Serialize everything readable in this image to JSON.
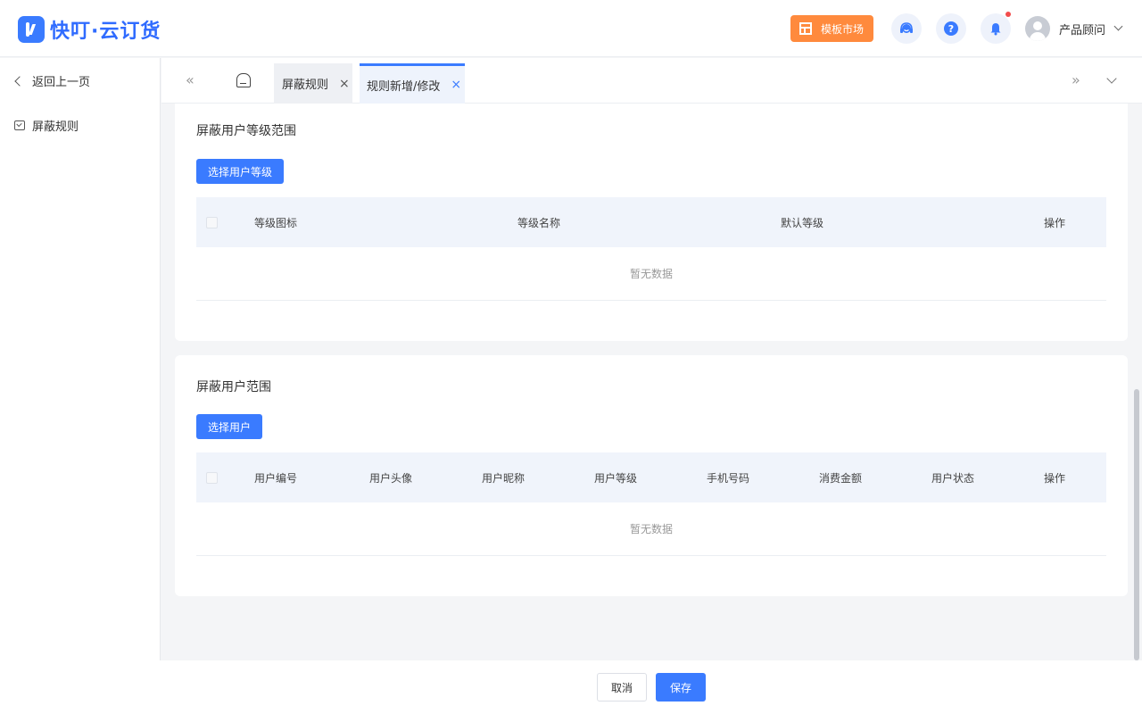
{
  "header": {
    "logo_text": "快叮·云订货",
    "template_market_label": "模板市场",
    "help_glyph": "?",
    "user_name": "产品顾问"
  },
  "sidebar": {
    "back_label": "返回上一页",
    "items": [
      {
        "label": "屏蔽规则",
        "icon": "checkbox-icon"
      }
    ]
  },
  "tabs": {
    "prev_glyph": "«",
    "next_glyph": "»",
    "close_glyph": "×",
    "items": [
      {
        "label": "屏蔽规则",
        "active": false
      },
      {
        "label": "规则新增/修改",
        "active": true
      }
    ]
  },
  "level_section": {
    "title": "屏蔽用户等级范围",
    "button_label": "选择用户等级",
    "columns": [
      "等级图标",
      "等级名称",
      "默认等级",
      "操作"
    ],
    "empty_text": "暂无数据"
  },
  "user_section": {
    "title": "屏蔽用户范围",
    "button_label": "选择用户",
    "columns": [
      "用户编号",
      "用户头像",
      "用户昵称",
      "用户等级",
      "手机号码",
      "消费金额",
      "用户状态",
      "操作"
    ],
    "empty_text": "暂无数据"
  },
  "footer": {
    "cancel_label": "取消",
    "save_label": "保存"
  },
  "colors": {
    "primary": "#3a7bff",
    "template_button": "#ff8a3d",
    "notification_dot": "#f24c4c"
  }
}
